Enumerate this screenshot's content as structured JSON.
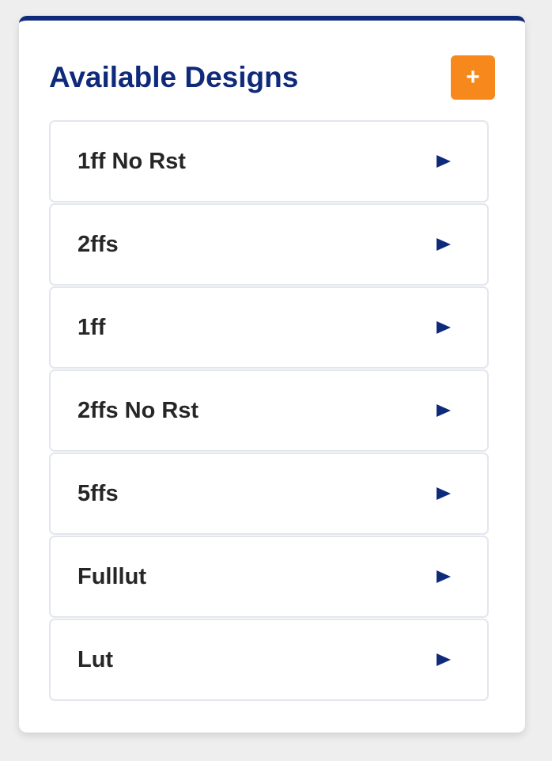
{
  "panel": {
    "title": "Available Designs",
    "add_button": {
      "label": "+",
      "icon": "plus-icon"
    },
    "accent_color": "#0f2a7a",
    "add_button_color": "#f7891c"
  },
  "designs": [
    {
      "label": "1ff No Rst",
      "icon": "play-arrow-icon"
    },
    {
      "label": "2ffs",
      "icon": "play-arrow-icon"
    },
    {
      "label": "1ff",
      "icon": "play-arrow-icon"
    },
    {
      "label": "2ffs No Rst",
      "icon": "play-arrow-icon"
    },
    {
      "label": "5ffs",
      "icon": "play-arrow-icon"
    },
    {
      "label": "Fulllut",
      "icon": "play-arrow-icon"
    },
    {
      "label": "Lut",
      "icon": "play-arrow-icon"
    }
  ]
}
